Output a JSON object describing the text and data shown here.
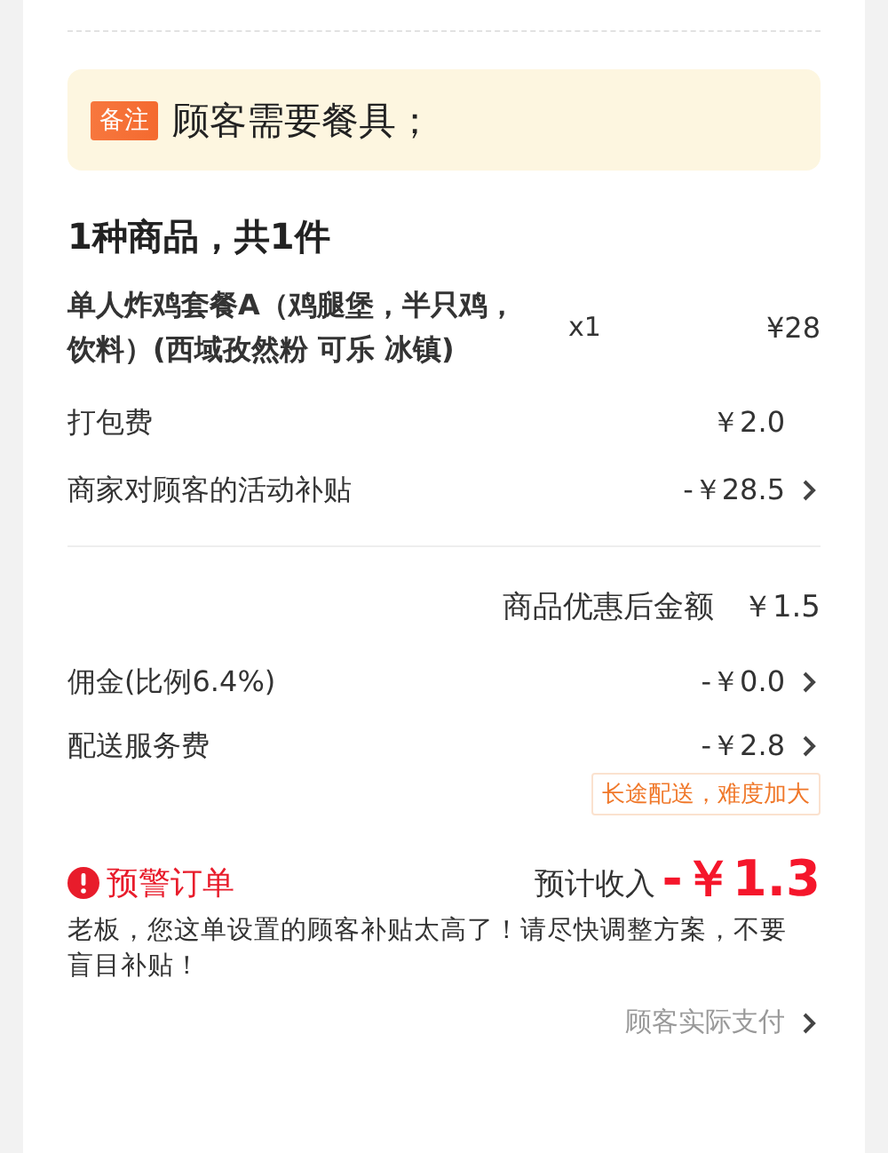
{
  "note": {
    "tag": "备注",
    "text": "顾客需要餐具；"
  },
  "goods": {
    "summary": "1种商品，共1件",
    "items": [
      {
        "name": "单人炸鸡套餐A（鸡腿堡，半只鸡，饮料）(西域孜然粉 可乐 冰镇)",
        "qty": "x1",
        "price": "¥28"
      }
    ]
  },
  "fees": [
    {
      "label": "打包费",
      "amount": "￥2.0",
      "link": false
    },
    {
      "label": "商家对顾客的活动补贴",
      "amount": "-￥28.5",
      "link": true
    }
  ],
  "subtotal": {
    "label": "商品优惠后金额",
    "amount": "￥1.5"
  },
  "deductions": [
    {
      "label": "佣金(比例6.4%)",
      "amount": "-￥0.0",
      "link": true
    },
    {
      "label": "配送服务费",
      "amount": "-￥2.8",
      "link": true,
      "tag": "长途配送，难度加大"
    }
  ],
  "warning": {
    "title": "预警订单",
    "income_label": "预计收入",
    "income": "-￥1.3",
    "message": "老板，您这单设置的顾客补贴太高了！请尽快调整方案，不要盲目补贴！"
  },
  "footer_link": "顾客实际支付"
}
